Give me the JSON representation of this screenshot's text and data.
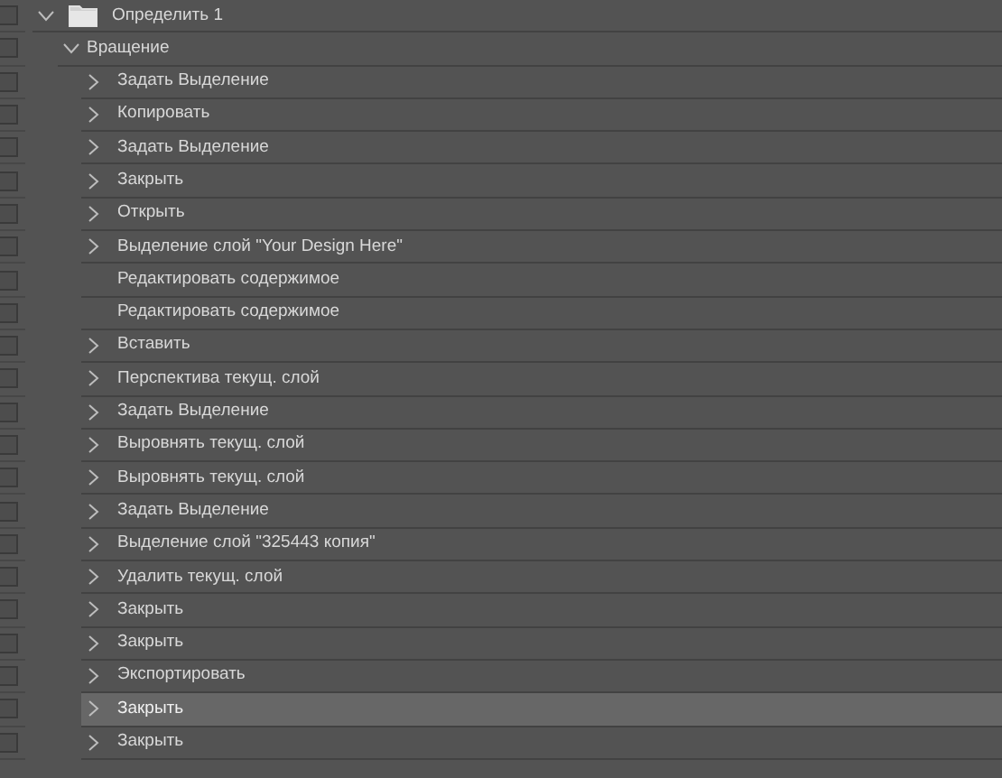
{
  "actions": [
    {
      "name": "Определить 1",
      "expanded": true,
      "children": [
        {
          "name": "Вращение",
          "expanded": true,
          "children": [
            {
              "name": "Задать Выделение",
              "kind": "step",
              "selected": false
            },
            {
              "name": "Копировать",
              "kind": "step",
              "selected": false
            },
            {
              "name": "Задать Выделение",
              "kind": "step",
              "selected": false
            },
            {
              "name": "Закрыть",
              "kind": "step",
              "selected": false
            },
            {
              "name": "Открыть",
              "kind": "step",
              "selected": false
            },
            {
              "name": "Выделение слой \"Your Design Here\"",
              "kind": "step",
              "selected": false
            },
            {
              "name": "Редактировать содержимое",
              "kind": "plain",
              "selected": false
            },
            {
              "name": "Редактировать содержимое",
              "kind": "plain",
              "selected": false
            },
            {
              "name": "Вставить",
              "kind": "step",
              "selected": false
            },
            {
              "name": "Перспектива текущ. слой",
              "kind": "step",
              "selected": false
            },
            {
              "name": "Задать Выделение",
              "kind": "step",
              "selected": false
            },
            {
              "name": "Выровнять текущ. слой",
              "kind": "step",
              "selected": false
            },
            {
              "name": "Выровнять текущ. слой",
              "kind": "step",
              "selected": false
            },
            {
              "name": "Задать Выделение",
              "kind": "step",
              "selected": false
            },
            {
              "name": "Выделение слой \"325443 копия\"",
              "kind": "step",
              "selected": false
            },
            {
              "name": "Удалить текущ. слой",
              "kind": "step",
              "selected": false
            },
            {
              "name": "Закрыть",
              "kind": "step",
              "selected": false
            },
            {
              "name": "Закрыть",
              "kind": "step",
              "selected": false
            },
            {
              "name": "Экспортировать",
              "kind": "step",
              "selected": false
            },
            {
              "name": "Закрыть",
              "kind": "step",
              "selected": true
            },
            {
              "name": "Закрыть",
              "kind": "step",
              "selected": false
            }
          ]
        }
      ]
    }
  ]
}
